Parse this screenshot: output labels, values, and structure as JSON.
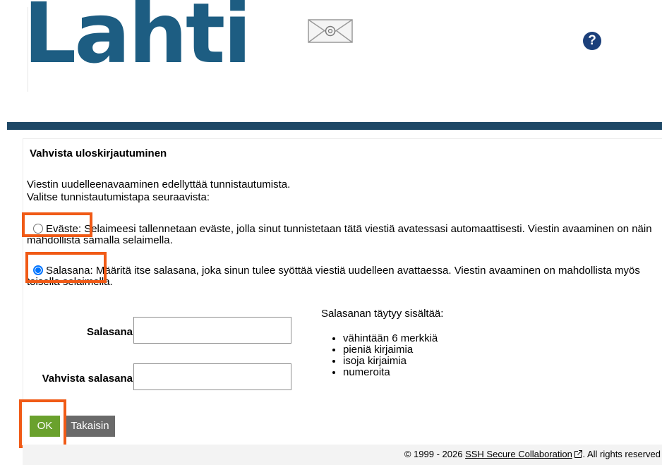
{
  "header": {
    "logo_text": "Lahti",
    "logo_color": "#1d5d82",
    "mail_icon": "envelope-at-icon",
    "help_icon_text": "?"
  },
  "colors": {
    "top_bar": "#1e4866",
    "ok_button": "#6aa12d",
    "back_button": "#6a6a6a",
    "highlight": "#f05a16",
    "radio_selected": "#0075ff"
  },
  "form": {
    "title": "Vahvista uloskirjautuminen",
    "intro_line1": "Viestin uudelleenavaaminen edellyttää tunnistautumista.",
    "intro_line2": "Valitse tunnistautumistapa seuraavista:",
    "options": [
      {
        "label": "Eväste:",
        "description": "Selaimeesi tallennetaan eväste, jolla sinut tunnistetaan tätä viestiä avatessasi automaattisesti. Viestin avaaminen on näin mahdollista samalla selaimella.",
        "selected": false
      },
      {
        "label": "Salasana:",
        "description": "Määritä itse salasana, joka sinun tulee syöttää viestiä uudelleen avattaessa. Viestin avaaminen on mahdollista myös toisella selaimella.",
        "selected": true
      }
    ],
    "password_label": "Salasana",
    "password_value": "",
    "confirm_label": "Vahvista salasana",
    "confirm_value": "",
    "requirements_title": "Salasanan täytyy sisältää:",
    "requirements": [
      "vähintään 6 merkkiä",
      "pieniä kirjaimia",
      "isoja kirjaimia",
      "numeroita"
    ],
    "ok_label": "OK",
    "back_label": "Takaisin"
  },
  "footer": {
    "prefix": "© 1999 - 2026",
    "link_text": "SSH Secure Collaboration",
    "link_icon": "external-link-icon",
    "suffix": ". All rights reserved"
  }
}
